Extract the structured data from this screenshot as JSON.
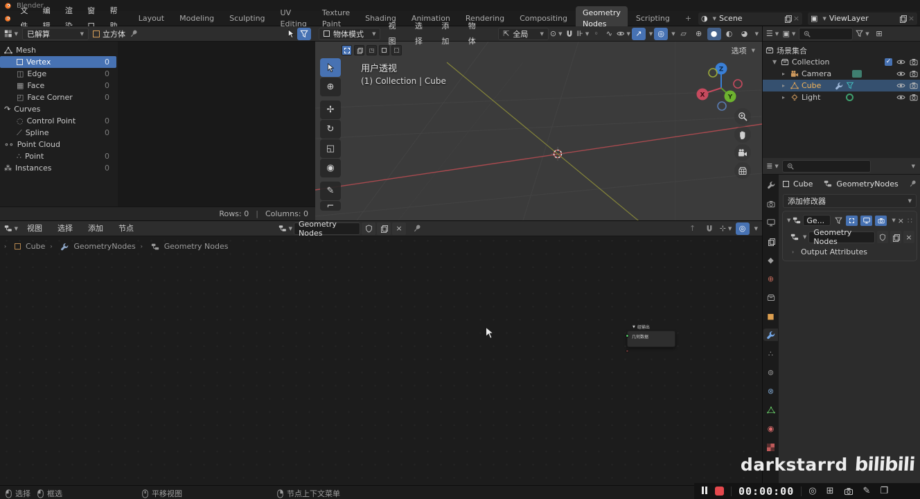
{
  "window": {
    "title": "Blender"
  },
  "topbar": {
    "menus": [
      "文件",
      "编辑",
      "渲染",
      "窗口",
      "帮助"
    ],
    "tabs": [
      "Layout",
      "Modeling",
      "Sculpting",
      "UV Editing",
      "Texture Paint",
      "Shading",
      "Animation",
      "Rendering",
      "Compositing",
      "Geometry Nodes",
      "Scripting"
    ],
    "active_tab": "Geometry Nodes",
    "add_tab": "+",
    "scene": {
      "label": "Scene"
    },
    "viewlayer": {
      "label": "ViewLayer"
    }
  },
  "spreadsheet": {
    "header": {
      "dataset": "已解算",
      "object": "立方体"
    },
    "groups": [
      {
        "label": "Mesh",
        "items": [
          {
            "label": "Vertex",
            "count": "0"
          },
          {
            "label": "Edge",
            "count": "0"
          },
          {
            "label": "Face",
            "count": "0"
          },
          {
            "label": "Face Corner",
            "count": "0"
          }
        ]
      },
      {
        "label": "Curves",
        "items": [
          {
            "label": "Control Point",
            "count": "0"
          },
          {
            "label": "Spline",
            "count": "0"
          }
        ]
      },
      {
        "label": "Point Cloud",
        "items": [
          {
            "label": "Point",
            "count": "0"
          }
        ]
      },
      {
        "label": "Instances",
        "count": "0",
        "items": []
      }
    ],
    "footer": {
      "rows": "Rows: 0",
      "separator": "|",
      "columns": "Columns: 0"
    }
  },
  "viewport": {
    "mode": "物体模式",
    "menus": [
      "视图",
      "选择",
      "添加",
      "物体"
    ],
    "orientation": "全局",
    "options": "选项",
    "overlay": {
      "view": "用户透视",
      "context": "(1) Collection | Cube"
    },
    "axes": {
      "x": "X",
      "y": "Y",
      "z": "Z"
    }
  },
  "node_editor": {
    "menus": [
      "视图",
      "选择",
      "添加",
      "节点"
    ],
    "tree_name": "Geometry Nodes",
    "breadcrumb": [
      "Cube",
      "GeometryNodes",
      "Geometry Nodes"
    ],
    "node": {
      "title": "组输出",
      "socket": "几何数据"
    }
  },
  "outliner": {
    "scene_collection": "场景集合",
    "rows": [
      {
        "label": "Collection"
      },
      {
        "label": "Camera"
      },
      {
        "label": "Cube"
      },
      {
        "label": "Light"
      }
    ]
  },
  "properties": {
    "breadcrumb": {
      "object": "Cube",
      "modifier": "GeometryNodes"
    },
    "add_modifier": "添加修改器",
    "modifier": {
      "name": "Ge...",
      "tree_name": "Geometry Nodes",
      "output_attributes": "Output Attributes"
    }
  },
  "statusbar": {
    "hints": [
      "选择",
      "框选",
      "平移视图",
      "节点上下文菜单"
    ]
  },
  "recorder": {
    "time": "00:00:00"
  },
  "watermark": {
    "name": "darkstarrd",
    "logo": "bilibili"
  },
  "colors": {
    "accent": "#4772b3",
    "selection_row": "#35506f",
    "record_red": "#e5484d",
    "axis_x": "#d14a5e",
    "axis_y": "#6db32f",
    "axis_z": "#3a7fd6"
  }
}
